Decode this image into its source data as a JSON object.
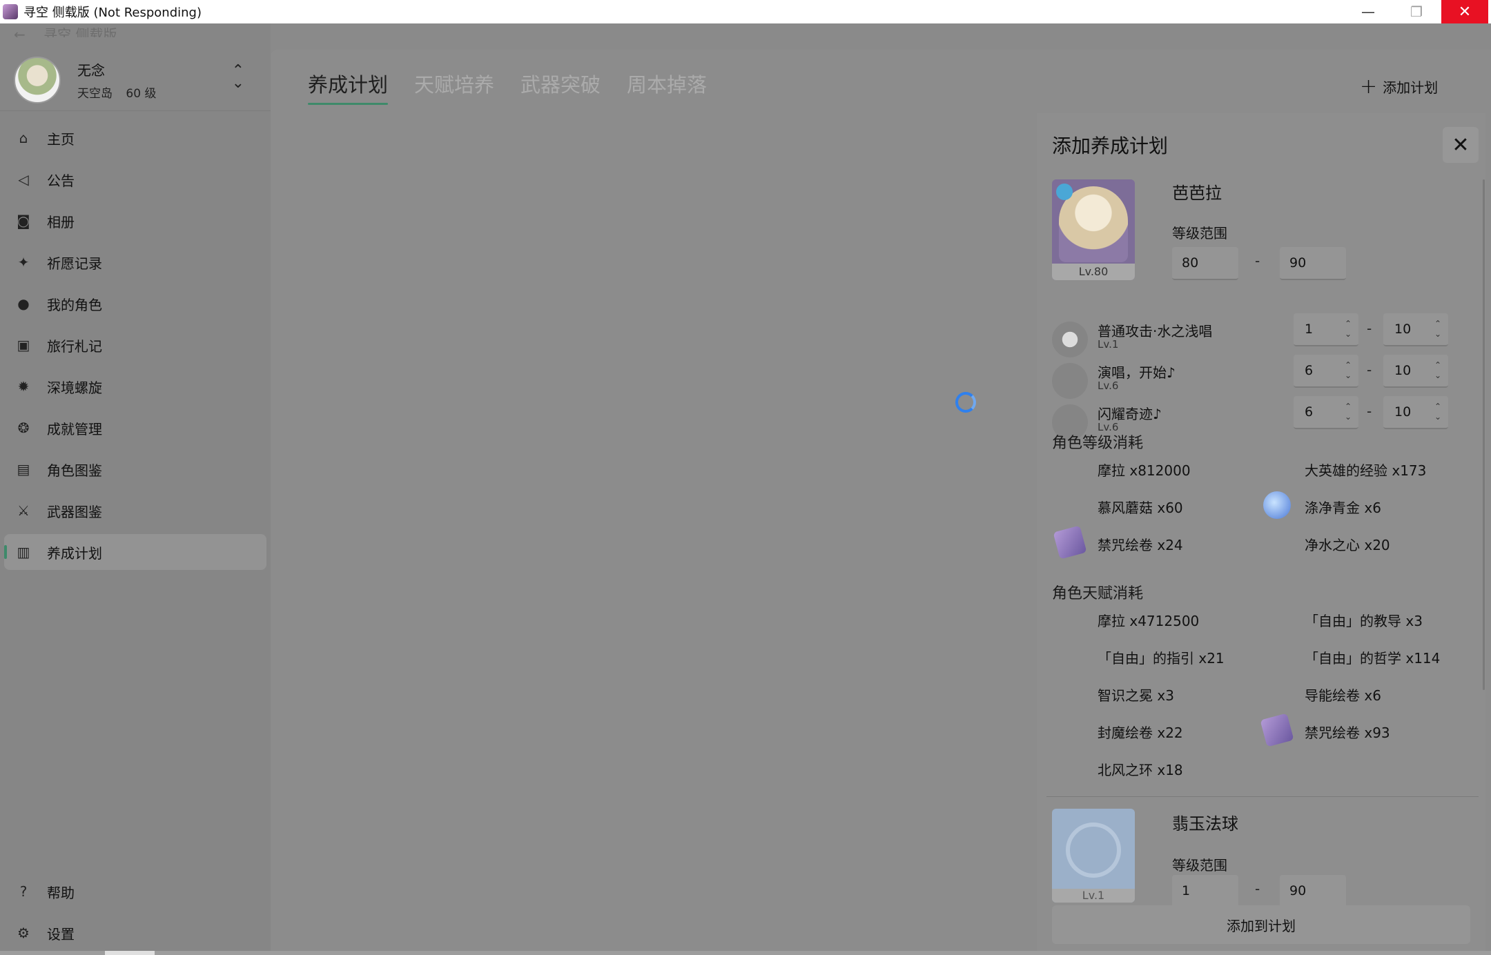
{
  "window": {
    "title": "寻空 侧载版 (Not Responding)",
    "minimize_icon": "—",
    "maximize_icon": "❐",
    "close_icon": "✕"
  },
  "sidebar": {
    "back_label": "寻空 侧载版",
    "user": {
      "name": "无念",
      "server": "天空岛",
      "level": "60 级"
    },
    "items": [
      {
        "label": "主页",
        "icon": "home-icon",
        "glyph": "⌂"
      },
      {
        "label": "公告",
        "icon": "megaphone-icon",
        "glyph": "◁"
      },
      {
        "label": "相册",
        "icon": "camera-icon",
        "glyph": "◙"
      },
      {
        "label": "祈愿记录",
        "icon": "sparkle-icon",
        "glyph": "✦"
      },
      {
        "label": "我的角色",
        "icon": "character-icon",
        "glyph": "●"
      },
      {
        "label": "旅行札记",
        "icon": "notebook-icon",
        "glyph": "▣"
      },
      {
        "label": "深境螺旋",
        "icon": "abyss-icon",
        "glyph": "✹"
      },
      {
        "label": "成就管理",
        "icon": "achievement-icon",
        "glyph": "❂"
      },
      {
        "label": "角色图鉴",
        "icon": "character-archive-icon",
        "glyph": "▤"
      },
      {
        "label": "武器图鉴",
        "icon": "weapon-archive-icon",
        "glyph": "⚔"
      },
      {
        "label": "养成计划",
        "icon": "plan-icon",
        "glyph": "▥"
      }
    ],
    "bottom_items": [
      {
        "label": "帮助",
        "icon": "help-icon",
        "glyph": "?"
      },
      {
        "label": "设置",
        "icon": "settings-icon",
        "glyph": "⚙"
      }
    ],
    "active_index": 10
  },
  "main": {
    "tabs": [
      "养成计划",
      "天赋培养",
      "武器突破",
      "周本掉落"
    ],
    "active_tab": 0,
    "add_plan_label": "添加计划",
    "loading": true
  },
  "panel": {
    "title": "添加养成计划",
    "character": {
      "name": "芭芭拉",
      "card_level": "Lv.80",
      "level_range_label": "等级范围",
      "level_from": "80",
      "level_to": "90",
      "element_color": "#4aa7d6"
    },
    "talents": [
      {
        "name": "普通攻击·水之浅唱",
        "lv": "Lv.1",
        "from": "1",
        "to": "10"
      },
      {
        "name": "演唱，开始♪",
        "lv": "Lv.6",
        "from": "6",
        "to": "10"
      },
      {
        "name": "闪耀奇迹♪",
        "lv": "Lv.6",
        "from": "6",
        "to": "10"
      }
    ],
    "level_cost_title": "角色等级消耗",
    "level_costs": [
      {
        "label": "摩拉 x812000",
        "icon": ""
      },
      {
        "label": "大英雄的经验 x173",
        "icon": ""
      },
      {
        "label": "慕风蘑菇 x60",
        "icon": ""
      },
      {
        "label": "涤净青金 x6",
        "icon": "gem"
      },
      {
        "label": "禁咒绘卷 x24",
        "icon": "scroll"
      },
      {
        "label": "净水之心 x20",
        "icon": ""
      }
    ],
    "talent_cost_title": "角色天赋消耗",
    "talent_costs": [
      {
        "label": "摩拉 x4712500",
        "icon": ""
      },
      {
        "label": "「自由」的教导 x3",
        "icon": ""
      },
      {
        "label": "「自由」的指引 x21",
        "icon": ""
      },
      {
        "label": "「自由」的哲学 x114",
        "icon": ""
      },
      {
        "label": "智识之冕 x3",
        "icon": ""
      },
      {
        "label": "导能绘卷 x6",
        "icon": ""
      },
      {
        "label": "封魔绘卷 x22",
        "icon": ""
      },
      {
        "label": "禁咒绘卷 x93",
        "icon": "scroll"
      },
      {
        "label": "北风之环 x18",
        "icon": ""
      }
    ],
    "weapon": {
      "name": "翡玉法球",
      "card_level": "Lv.1",
      "level_range_label": "等级范围",
      "level_from": "1",
      "level_to": "90"
    },
    "dash": "-",
    "submit_label": "添加到计划",
    "close_icon": "✕"
  }
}
